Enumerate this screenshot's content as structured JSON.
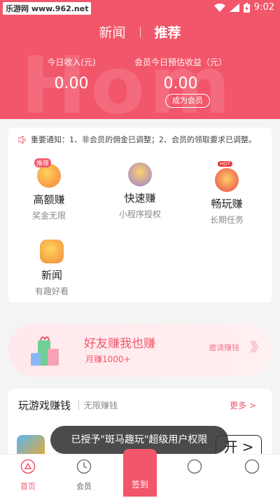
{
  "status_bar": {
    "site": "乐游网 www.962.net",
    "time": "9:02"
  },
  "header": {
    "watermark": "Hom",
    "nav": {
      "news": "新闻",
      "recommend": "推荐"
    },
    "income_left": {
      "label": "今日收入(元)",
      "value": "0.00"
    },
    "income_right": {
      "label": "会员今日预估收益（元）",
      "value": "0.00"
    },
    "member_button": "成为会员"
  },
  "notice": "重要通知：1、非会员的佣金已调整；2、会员的领取要求已调整。",
  "features": [
    {
      "title": "高额赚",
      "sub": "奖金无限",
      "tag": "推荐"
    },
    {
      "title": "快速赚",
      "sub": "小程序授权"
    },
    {
      "title": "畅玩赚",
      "sub": "长期任务",
      "tag": "HOT"
    },
    {
      "title": "新闻",
      "sub": "有趣好看"
    }
  ],
  "banner": {
    "title": "好友赚我也赚",
    "sub": "月赚1000+",
    "invite": "邀请赚钱",
    "arrows": "》》"
  },
  "games": {
    "title": "玩游戏赚钱",
    "sub": "无限赚钱",
    "more": "更多 >",
    "play_button": "开 >"
  },
  "toast": "已授予\"斑马趣玩\"超级用户权限",
  "tabbar": {
    "home": "首页",
    "member": "会员",
    "signin": "签到"
  },
  "colors": {
    "brand": "#f2566a"
  }
}
